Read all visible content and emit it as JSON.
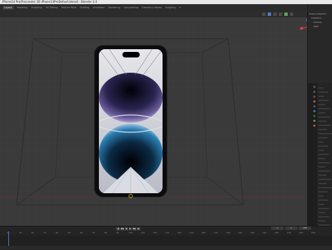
{
  "window": {
    "title": "iPhone14 Pro(Procreate) 3D iPhone14ProDefault.blend] - Blender 3.4"
  },
  "workspaces": {
    "items": [
      "Layout",
      "Modeling",
      "Sculpting",
      "UV Editing",
      "Texture Paint",
      "Shading",
      "Animation",
      "Rendering",
      "Compositing",
      "Geometry Nodes",
      "Scripting"
    ],
    "add_label": "+"
  },
  "outliner": {
    "rows": [
      "Scene Collection",
      "Collection",
      "Camera",
      "Light"
    ]
  },
  "timeline": {
    "controls": [
      "|◀",
      "◀◀",
      "◀",
      "▶",
      "▶▶",
      "▶|"
    ],
    "frame_current": "1",
    "frame_start": "1",
    "frame_end": "250",
    "ruler": [
      "0",
      "10",
      "20",
      "30",
      "40",
      "50",
      "60",
      "70",
      "80",
      "90",
      "100",
      "110",
      "120",
      "130",
      "140",
      "150",
      "160",
      "170",
      "180",
      "190",
      "200",
      "210",
      "220",
      "230",
      "240",
      "250"
    ]
  },
  "colors": {
    "viewport_bg": "#3a3a3a",
    "accent_blue": "#3f7fd8",
    "gizmo_x": "#d9414f",
    "gizmo_y": "#7fb03a",
    "gizmo_z": "#3f7fd8"
  }
}
